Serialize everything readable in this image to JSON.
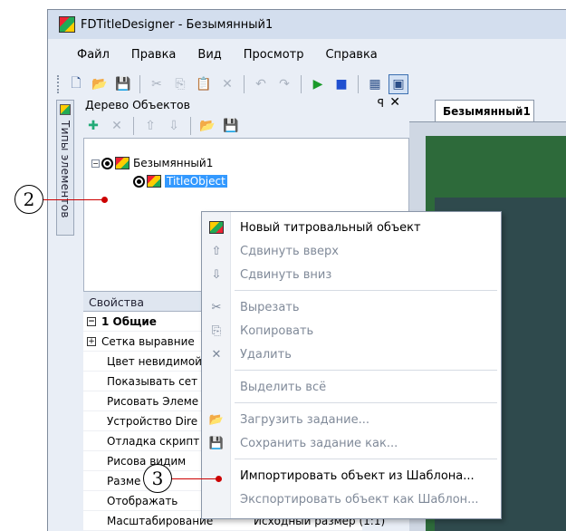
{
  "window": {
    "title": "FDTitleDesigner - Безымянный1"
  },
  "menu": [
    "Файл",
    "Правка",
    "Вид",
    "Просмотр",
    "Справка"
  ],
  "side_tab": {
    "label": "Типы элементов"
  },
  "object_tree": {
    "title": "Дерево Объектов",
    "pin": "ꟼ",
    "close": "✕",
    "root": "Безымянный1",
    "child": "TitleObject"
  },
  "properties": {
    "title": "Свойства",
    "rows": [
      {
        "label": "1 Общие",
        "box": "−",
        "bold": true
      },
      {
        "label": "Сетка выравние",
        "box": "+"
      },
      {
        "label": "Цвет невидимой"
      },
      {
        "label": "Показывать сет"
      },
      {
        "label": "Рисовать Элеме"
      },
      {
        "label": "Устройство Dire"
      },
      {
        "label": "Отладка скрипт"
      },
      {
        "label": "Рисова   видим"
      },
      {
        "label": "Разме    иди"
      },
      {
        "label": "Отображать"
      },
      {
        "label": "Масштабирование",
        "value": "Исходный размер (1:1)"
      }
    ]
  },
  "document_tab": "Безымянный1",
  "context_menu": {
    "items": [
      {
        "label": "Новый титровальный объект",
        "enabled": true
      },
      {
        "label": "Сдвинуть вверх",
        "enabled": false
      },
      {
        "label": "Сдвинуть вниз",
        "enabled": false
      },
      {
        "label": "Вырезать",
        "enabled": false
      },
      {
        "label": "Копировать",
        "enabled": false
      },
      {
        "label": "Удалить",
        "enabled": false
      },
      {
        "label": "Выделить всё",
        "enabled": false
      },
      {
        "label": "Загрузить задание...",
        "enabled": false
      },
      {
        "label": "Сохранить задание как...",
        "enabled": false
      },
      {
        "label": "Импортировать объект из Шаблона...",
        "enabled": true
      },
      {
        "label": "Экспортировать объект как  Шаблон...",
        "enabled": false
      }
    ]
  },
  "callouts": {
    "two": "2",
    "three": "3"
  },
  "colors": {
    "accent_red": "#cc0000",
    "selection": "#3399ff",
    "canvas_green": "#2d6a3a"
  }
}
